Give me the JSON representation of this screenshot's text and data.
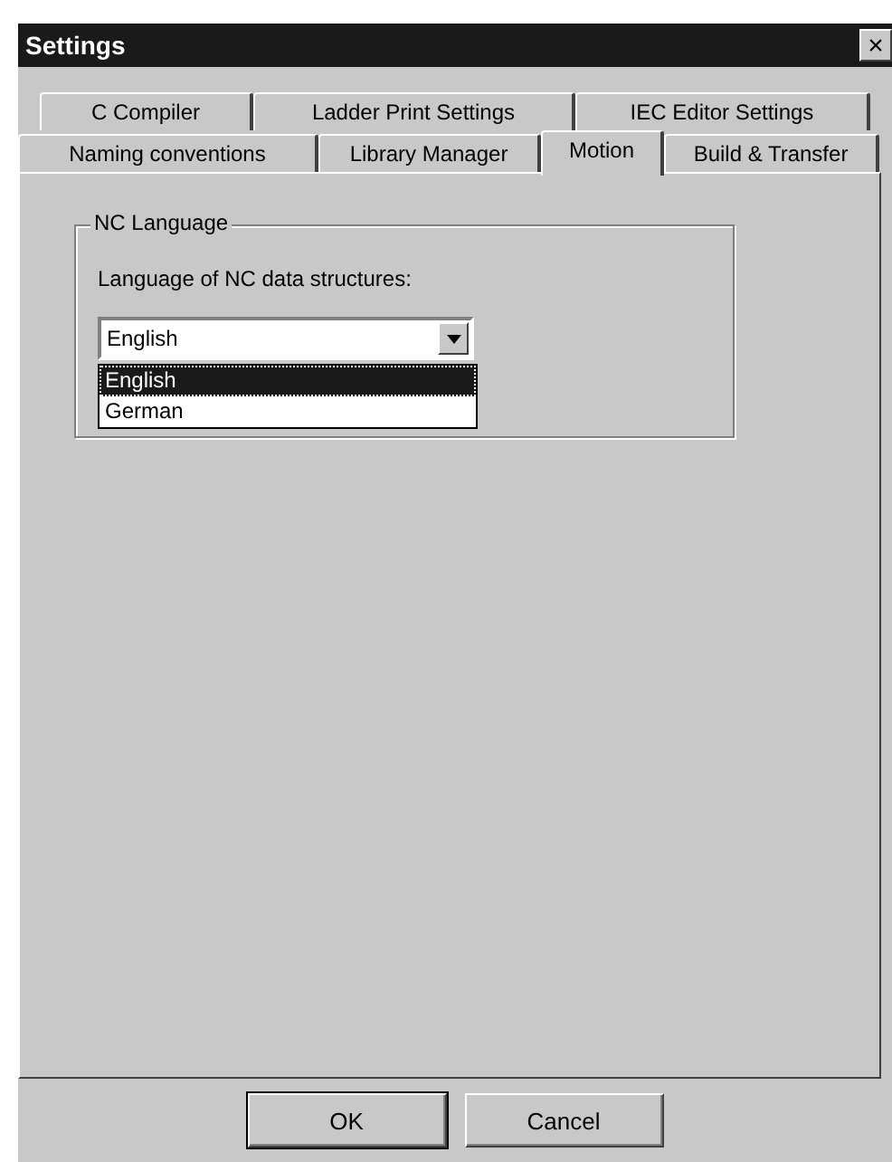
{
  "window": {
    "title": "Settings",
    "close": "×"
  },
  "tab_rows": [
    [
      {
        "label": "C Compiler",
        "selected": false
      },
      {
        "label": "Ladder Print Settings",
        "selected": false
      },
      {
        "label": "IEC Editor Settings",
        "selected": false
      }
    ],
    [
      {
        "label": "Naming conventions",
        "selected": false
      },
      {
        "label": "Library Manager",
        "selected": false
      },
      {
        "label": "Motion",
        "selected": true
      },
      {
        "label": "Build & Transfer",
        "selected": false
      }
    ]
  ],
  "group": {
    "title": "NC Language",
    "label": "Language of NC data structures:",
    "combo": {
      "value": "English",
      "expanded": true,
      "options": [
        {
          "label": "English",
          "selected": true
        },
        {
          "label": "German",
          "selected": false
        }
      ]
    }
  },
  "buttons": [
    {
      "label": "OK",
      "default": true
    },
    {
      "label": "Cancel",
      "default": false
    }
  ]
}
